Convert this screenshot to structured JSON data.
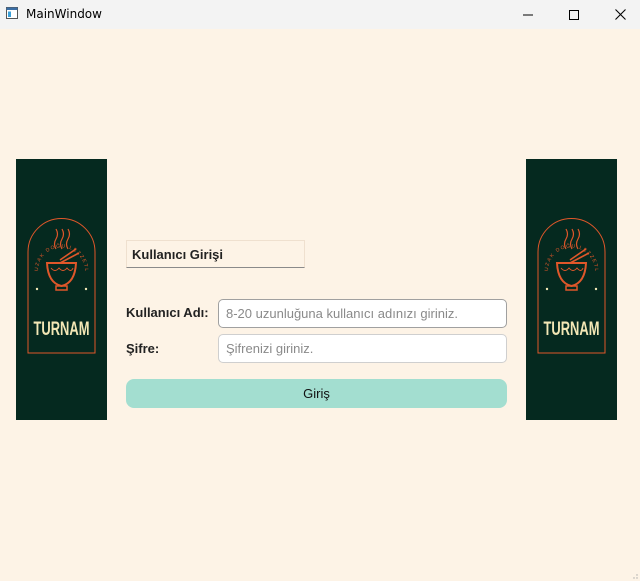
{
  "window": {
    "title": "MainWindow"
  },
  "controls": {
    "minimize_icon": "minimize-icon",
    "maximize_icon": "maximize-icon",
    "close_icon": "close-icon"
  },
  "banner": {
    "brand": "TURNAM",
    "arc_text": "UZAK DOĞU LEZZETLERİ"
  },
  "form": {
    "title": "Kullanıcı Girişi",
    "username_label": "Kullanıcı Adı:",
    "username_value": "",
    "username_placeholder": "8-20 uzunluğuna kullanıcı adınızı giriniz.",
    "password_label": "Şifre:",
    "password_value": "",
    "password_placeholder": "Şifrenizi giriniz.",
    "submit_label": "Giriş"
  },
  "colors": {
    "background": "#fdf3e6",
    "banner": "#05291f",
    "accent": "#a3ded0",
    "logo_orange": "#e0572a",
    "logo_cream": "#f3e7b5"
  }
}
